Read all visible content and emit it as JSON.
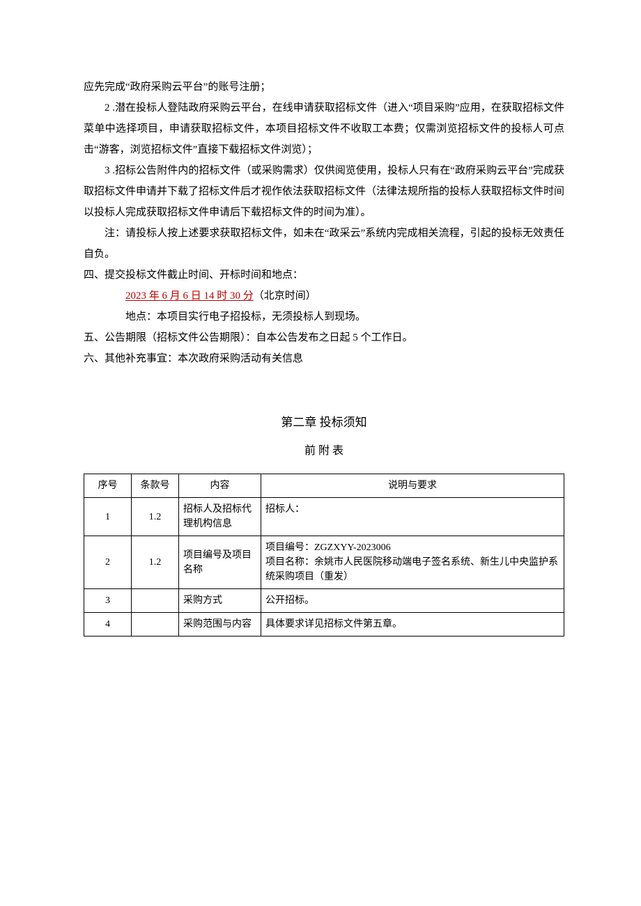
{
  "p1": "应先完成“政府采购云平台”的账号注册；",
  "p2_num": "2",
  "p2": " .潜在投标人登陆政府采购云平台，在线申请获取招标文件（进入“项目采购”应用，在获取招标文件菜单中选择项目，申请获取招标文件，本项目招标文件不收取工本费；仅需浏览招标文件的投标人可点击“游客，浏览招标文件”直接下载招标文件浏览）；",
  "p3_num": "3",
  "p3": " .招标公告附件内的招标文件（或采购需求）仅供阅览使用，投标人只有在“政府采购云平台”完成获取招标文件申请并下载了招标文件后才视作依法获取招标文件（法律法规所指的投标人获取招标文件时间以投标人完成获取招标文件申请后下载招标文件的时间为准）。",
  "p_note": "注：请投标人按上述要求获取招标文件，如未在“政采云”系统内完成相关流程，引起的投标无效责任自负。",
  "s4_head": "四、提交投标文件截止时间、开标时间和地点：",
  "s4_deadline": "2023 年 6 月 6 日 14 时 30 分",
  "s4_deadline_suffix": "（北京时间）",
  "s4_loc": "地点：本项目实行电子招投标，无须投标人到现场。",
  "s5": "五、公告期限（招标文件公告期限）：自本公告发布之日起 5 个工作日。",
  "s6": "六、其他补充事宜：本次政府采购活动有关信息",
  "chapter_title": "第二章 投标须知",
  "appendix_title": "前 附 表",
  "table": {
    "headers": {
      "seq": "序号",
      "clause": "条款号",
      "content": "内容",
      "desc": "说明与要求"
    },
    "rows": [
      {
        "seq": "1",
        "clause": "1.2",
        "content": "招标人及招标代理机构信息",
        "desc": "招标人："
      },
      {
        "seq": "2",
        "clause": "1.2",
        "content": "项目编号及项目名称",
        "desc": "项目编号：ZGZXYY-2023006\n项目名称：余姚市人民医院移动端电子签名系统、新生儿中央监护系统采购项目（重发）"
      },
      {
        "seq": "3",
        "clause": "",
        "content": "采购方式",
        "desc": "公开招标。"
      },
      {
        "seq": "4",
        "clause": "",
        "content": "采购范围与内容",
        "desc": "具体要求详见招标文件第五章。"
      }
    ]
  }
}
